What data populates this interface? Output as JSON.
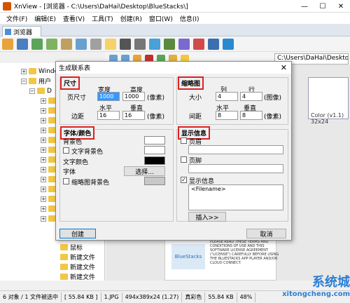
{
  "window": {
    "title": "XnView - [浏览器 - C:\\Users\\DaHai\\Desktop\\BlueStacks\\]",
    "min": "—",
    "max": "☐",
    "close": "✕"
  },
  "menu": [
    "文件(F)",
    "编辑(E)",
    "查看(V)",
    "工具(T)",
    "创建(R)",
    "窗口(W)",
    "信息(I)"
  ],
  "tab": {
    "label": "浏览器"
  },
  "address": "C:\\Users\\DaHai\\Desktop\\",
  "tree": [
    {
      "label": "Windo",
      "indent": 1
    },
    {
      "label": "用户",
      "indent": 1
    },
    {
      "label": "D",
      "indent": 2
    },
    {
      "label": "鼠标",
      "indent": 4
    },
    {
      "label": "新建文件",
      "indent": 4
    },
    {
      "label": "新建文件",
      "indent": 4
    },
    {
      "label": "新建文件",
      "indent": 4
    }
  ],
  "preview": {
    "thumb_caption": "Color (v1.1)",
    "thumb_size": "32x24",
    "doc_text": "PLEASE READ THESE TERMS AND CONDITIONS OF USE AND THIS SOFTWARE LICENSE AGREEMENT (\"LICENSE\") CAREFULLY BEFORE USING THE BLUESTACKS APP PLAYER AND/OR CLOUD CONNECT.",
    "logo": "BlueStacks"
  },
  "status": {
    "objects": "6 对象 / 1 文件被选中",
    "size": "[ 55.84 KB ]",
    "file": "1.JPG",
    "dims": "494x389x24 (1.27)",
    "color": "真彩色",
    "filesize": "55.84 KB",
    "zoom": "48%"
  },
  "watermark": {
    "logo": "系统城",
    "url": "xitongcheng.com"
  },
  "dialog": {
    "title": "生成联系表",
    "close": "✕",
    "size": {
      "title": "尺寸",
      "page_size_label": "页尺寸",
      "width_label": "宽度",
      "height_label": "高度",
      "width": "1000",
      "height": "1000",
      "unit": "(像素)",
      "margin_label": "边距",
      "hspace_label": "水平",
      "vspace_label": "垂直",
      "margin_h": "16",
      "margin_v": "16",
      "margin_unit": "(像素)"
    },
    "thumbs": {
      "title": "缩略图",
      "size_label": "大小",
      "cols_label": "列",
      "rows_label": "行",
      "cols": "4",
      "rows": "4",
      "unit": "(图像)",
      "gap_label": "间距",
      "hspace_label": "水平",
      "vspace_label": "垂直",
      "gap_h": "8",
      "gap_v": "8",
      "gap_unit": "(像素)"
    },
    "fontcolor": {
      "title": "字体/颜色",
      "bg_label": "背景色",
      "text_bg_label": "文字背景色",
      "text_color_label": "文字颜色",
      "font_label": "字体",
      "font_button": "选择...",
      "thumb_bg_label": "缩略图背景色",
      "colors": {
        "bg": "#ffffff",
        "text_bg": "#ffffff",
        "text": "#000000",
        "thumb_bg": "#c8c8c8"
      }
    },
    "info": {
      "title": "显示信息",
      "header_label": "页眉",
      "footer_label": "页脚",
      "show_info_label": "显示信息",
      "info_text": "<Filename>",
      "insert_button": "插入>>"
    },
    "create_button": "创建",
    "cancel_button": "取消"
  }
}
